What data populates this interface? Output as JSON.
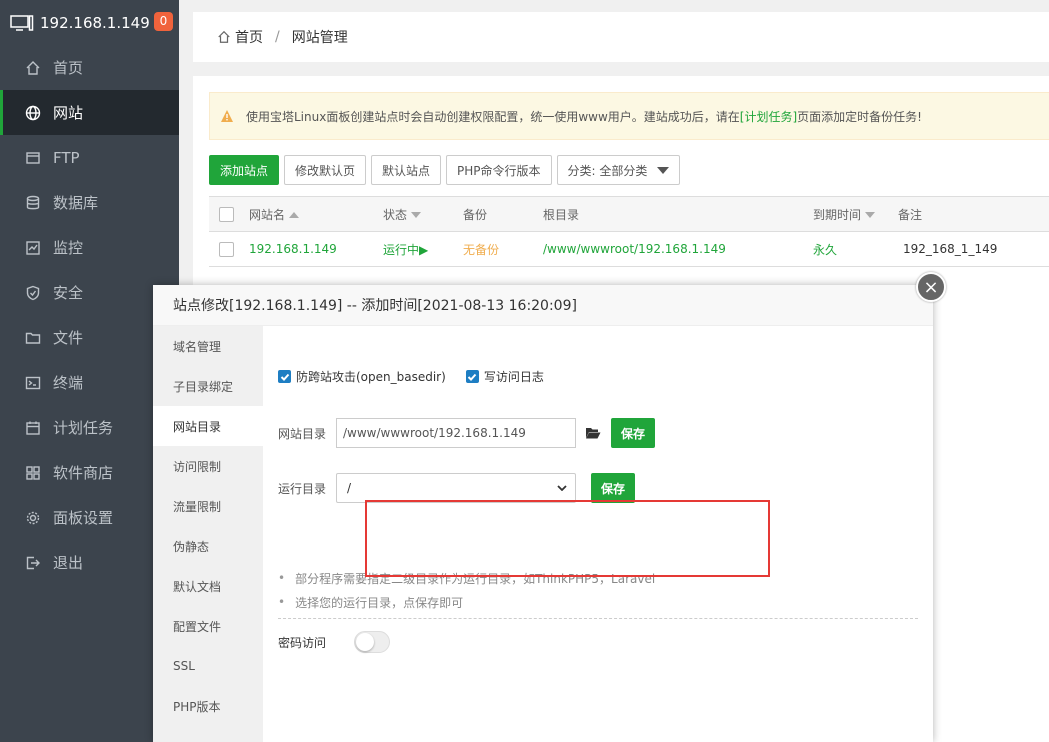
{
  "sidebar": {
    "host": "192.168.1.149",
    "badge": "0",
    "items": [
      {
        "label": "首页",
        "icon": "home-icon"
      },
      {
        "label": "网站",
        "icon": "globe-icon"
      },
      {
        "label": "FTP",
        "icon": "ftp-icon"
      },
      {
        "label": "数据库",
        "icon": "database-icon"
      },
      {
        "label": "监控",
        "icon": "monitor-icon"
      },
      {
        "label": "安全",
        "icon": "shield-icon"
      },
      {
        "label": "文件",
        "icon": "folder-icon"
      },
      {
        "label": "终端",
        "icon": "terminal-icon"
      },
      {
        "label": "计划任务",
        "icon": "calendar-icon"
      },
      {
        "label": "软件商店",
        "icon": "apps-icon"
      },
      {
        "label": "面板设置",
        "icon": "gear-icon"
      },
      {
        "label": "退出",
        "icon": "logout-icon"
      }
    ],
    "active_index": 1
  },
  "breadcrumb": {
    "home": "首页",
    "sep": "/",
    "current": "网站管理"
  },
  "warning": {
    "text_before": "使用宝塔Linux面板创建站点时会自动创建权限配置，统一使用www用户。建站成功后，请在",
    "link": "[计划任务]",
    "text_after": "页面添加定时备份任务!"
  },
  "toolbar": {
    "add_site": "添加站点",
    "edit_default_page": "修改默认页",
    "default_site": "默认站点",
    "php_cli": "PHP命令行版本",
    "category": "分类: 全部分类"
  },
  "table": {
    "headers": {
      "name": "网站名",
      "status": "状态",
      "backup": "备份",
      "root": "根目录",
      "expire": "到期时间",
      "note": "备注"
    },
    "rows": [
      {
        "name": "192.168.1.149",
        "status": "运行中▶",
        "backup": "无备份",
        "root": "/www/wwwroot/192.168.1.149",
        "expire": "永久",
        "note": "192_168_1_149"
      }
    ]
  },
  "modal": {
    "title": "站点修改[192.168.1.149] -- 添加时间[2021-08-13 16:20:09]",
    "close": "×",
    "tabs": [
      "域名管理",
      "子目录绑定",
      "网站目录",
      "访问限制",
      "流量限制",
      "伪静态",
      "默认文档",
      "配置文件",
      "SSL",
      "PHP版本"
    ],
    "active_tab": 2,
    "anti_xss_label": "防跨站攻击(open_basedir)",
    "access_log_label": "写访问日志",
    "site_dir_label": "网站目录",
    "site_dir_value": "/www/wwwroot/192.168.1.149",
    "save_label": "保存",
    "run_dir_label": "运行目录",
    "run_dir_value": "/",
    "tips": [
      "部分程序需要指定二级目录作为运行目录，如ThinkPHP5，Laravel",
      "选择您的运行目录，点保存即可"
    ],
    "password_label": "密码访问"
  },
  "colors": {
    "accent": "#20a53a",
    "sidebar_bg": "#3c444d",
    "highlight_box": "#e53935"
  }
}
